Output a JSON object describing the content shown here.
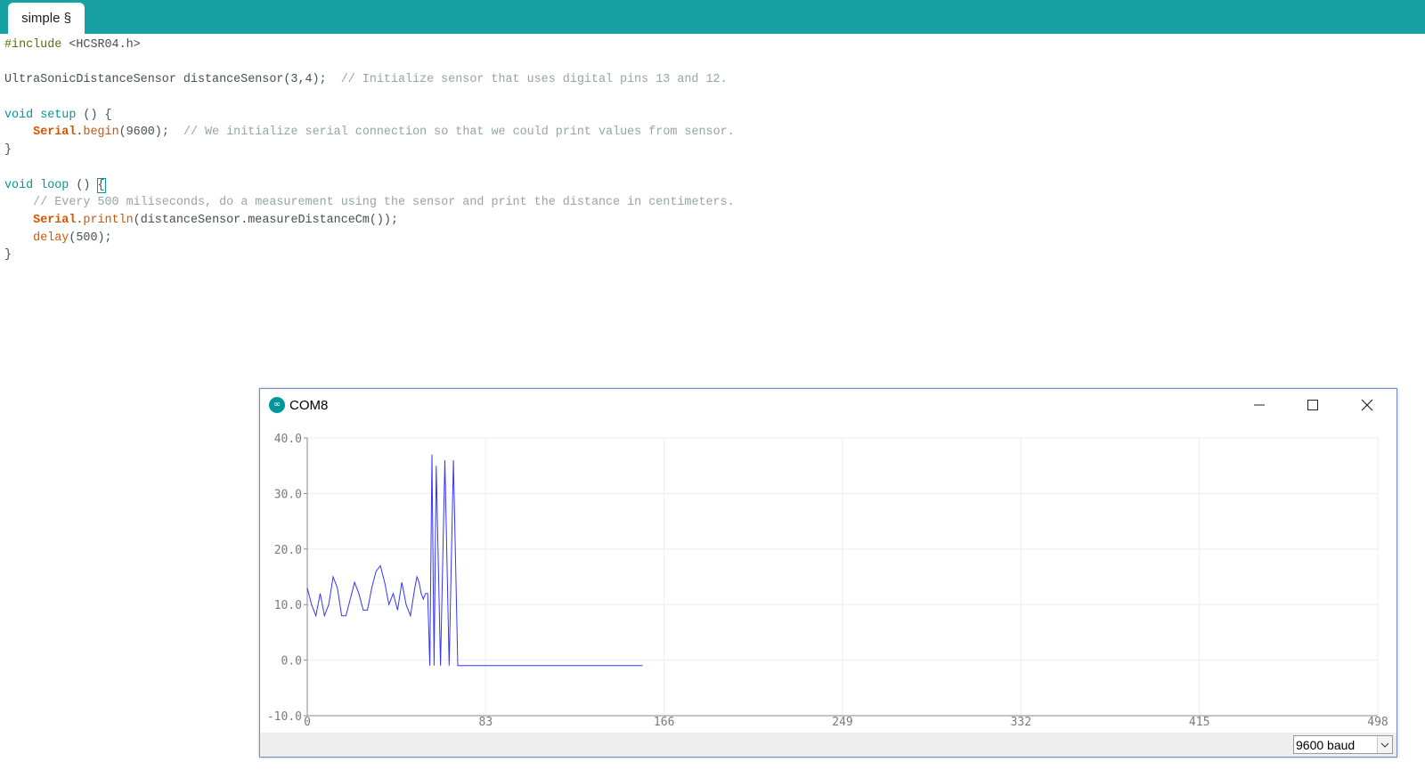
{
  "tab": {
    "label": "simple §"
  },
  "code_lines": [
    [
      {
        "t": "#include",
        "c": "pre"
      },
      {
        "t": " <HCSR04.h>",
        "c": "plain"
      }
    ],
    [],
    [
      {
        "t": "UltraSonicDistanceSensor distanceSensor(3,4);  ",
        "c": "plain"
      },
      {
        "t": "// Initialize sensor that uses digital pins 13 and 12.",
        "c": "cm"
      }
    ],
    [],
    [
      {
        "t": "void",
        "c": "kw"
      },
      {
        "t": " ",
        "c": "plain"
      },
      {
        "t": "setup",
        "c": "kw"
      },
      {
        "t": " () {",
        "c": "plain"
      }
    ],
    [
      {
        "t": "    ",
        "c": "plain"
      },
      {
        "t": "Serial",
        "c": "cls"
      },
      {
        "t": ".",
        "c": "plain"
      },
      {
        "t": "begin",
        "c": "fn"
      },
      {
        "t": "(9600);  ",
        "c": "plain"
      },
      {
        "t": "// We initialize serial connection so that we could print values from sensor.",
        "c": "cm"
      }
    ],
    [
      {
        "t": "}",
        "c": "plain"
      }
    ],
    [],
    [
      {
        "t": "void",
        "c": "kw"
      },
      {
        "t": " ",
        "c": "plain"
      },
      {
        "t": "loop",
        "c": "kw"
      },
      {
        "t": " () ",
        "c": "plain"
      },
      {
        "t": "{",
        "c": "brace"
      }
    ],
    [
      {
        "t": "    ",
        "c": "plain"
      },
      {
        "t": "// Every 500 miliseconds, do a measurement using the sensor and print the distance in centimeters.",
        "c": "cm"
      }
    ],
    [
      {
        "t": "    ",
        "c": "plain"
      },
      {
        "t": "Serial",
        "c": "cls"
      },
      {
        "t": ".",
        "c": "plain"
      },
      {
        "t": "println",
        "c": "fn"
      },
      {
        "t": "(distanceSensor.measureDistanceCm());",
        "c": "plain"
      }
    ],
    [
      {
        "t": "    ",
        "c": "plain"
      },
      {
        "t": "delay",
        "c": "fn"
      },
      {
        "t": "(500);",
        "c": "plain"
      }
    ],
    [
      {
        "t": "}",
        "c": "plain"
      }
    ]
  ],
  "plotter": {
    "title": "COM8",
    "baud": "9600 baud",
    "icons": {
      "app": "arduino-icon",
      "minimize": "minimize-icon",
      "maximize": "maximize-icon",
      "close": "close-icon",
      "dropdown": "chevron-down-icon"
    }
  },
  "colors": {
    "tabbar": "#17a1a5",
    "series": "#3434ff",
    "grid": "#eeeeee",
    "axis": "#888888"
  },
  "chart_data": {
    "type": "line",
    "xlim": [
      0,
      498
    ],
    "ylim": [
      -10,
      40
    ],
    "y_ticks": [
      "40.0",
      "30.0",
      "20.0",
      "10.0",
      "0.0",
      "-10.0"
    ],
    "x_ticks": [
      "0",
      "83",
      "166",
      "249",
      "332",
      "415",
      "498"
    ],
    "grid": true,
    "series": [
      {
        "x": [
          0,
          2,
          4,
          6,
          8,
          10,
          12,
          14,
          16,
          18,
          20,
          22,
          24,
          26,
          28,
          30,
          32,
          34,
          36,
          38,
          40,
          42,
          44,
          46,
          48,
          50,
          51,
          52,
          53,
          54,
          55,
          56,
          57,
          58,
          59,
          60,
          62,
          64,
          66,
          68,
          70,
          72,
          74,
          76,
          78,
          80,
          82,
          84,
          86,
          88,
          90,
          92,
          94,
          96,
          98,
          100,
          102,
          104,
          106,
          108,
          110,
          112,
          114,
          116,
          118,
          120,
          122,
          124,
          126,
          128,
          130,
          131,
          132,
          133,
          134,
          135,
          136,
          137,
          138,
          139,
          140,
          141,
          142,
          143,
          144,
          145,
          146,
          147,
          148,
          149,
          150,
          151,
          152,
          153,
          154,
          155,
          156
        ],
        "y": [
          13,
          10,
          8,
          12,
          8,
          10,
          15,
          13,
          8,
          8,
          11,
          14,
          12,
          9,
          9,
          13,
          16,
          17,
          14,
          10,
          12,
          9,
          14,
          10,
          8,
          13,
          15,
          14,
          12,
          11,
          12,
          12,
          -1,
          37,
          -1,
          35,
          -1,
          36,
          -1,
          36,
          -1,
          -1,
          -1,
          -1,
          -1,
          -1,
          -1,
          -1,
          -1,
          -1,
          -1,
          -1,
          -1,
          -1,
          -1,
          -1,
          -1,
          -1,
          -1,
          -1,
          -1,
          -1,
          -1,
          -1,
          -1,
          -1,
          -1,
          -1,
          -1,
          -1,
          -1,
          -1,
          -1,
          -1,
          -1,
          -1,
          -1,
          -1,
          -1,
          -1,
          -1,
          -1,
          -1,
          -1,
          -1,
          -1,
          -1,
          -1,
          -1,
          -1,
          -1,
          -1,
          -1,
          -1,
          -1,
          -1,
          -1
        ]
      }
    ]
  }
}
